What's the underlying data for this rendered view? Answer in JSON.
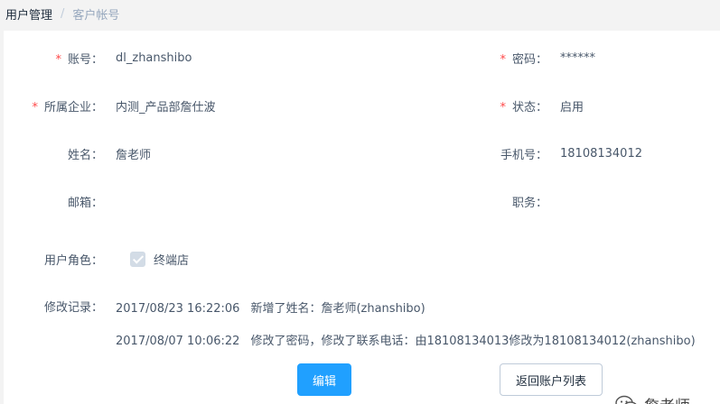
{
  "breadcrumb": {
    "parent": "用户管理",
    "current": "客户帐号"
  },
  "form": {
    "account": {
      "label": "账号：",
      "value": "dl_zhanshibo"
    },
    "password": {
      "label": "密码：",
      "value": "******"
    },
    "company": {
      "label": "所属企业：",
      "value": "内测_产品部詹仕波"
    },
    "status": {
      "label": "状态：",
      "value": "启用"
    },
    "name": {
      "label": "姓名：",
      "value": "詹老师"
    },
    "phone": {
      "label": "手机号：",
      "value": "18108134012"
    },
    "email": {
      "label": "邮箱：",
      "value": ""
    },
    "position": {
      "label": "职务：",
      "value": ""
    },
    "role": {
      "label": "用户角色：",
      "option": "终端店",
      "checked": true,
      "disabled": true
    },
    "history": {
      "label": "修改记录：",
      "entries": [
        {
          "time": "2017/08/23 16:22:06",
          "text": "新增了姓名：詹老师(zhanshibo)"
        },
        {
          "time": "2017/08/07 10:06:22",
          "text": "修改了密码，修改了联系电话：由18108134013修改为18108134012(zhanshibo)"
        }
      ]
    }
  },
  "buttons": {
    "edit": "编辑",
    "back": "返回账户列表"
  },
  "watermark": {
    "text": "詹老师"
  },
  "required_mark": "*",
  "colors": {
    "primary": "#20a0ff",
    "required": "#ff4949",
    "text": "#48576a"
  }
}
